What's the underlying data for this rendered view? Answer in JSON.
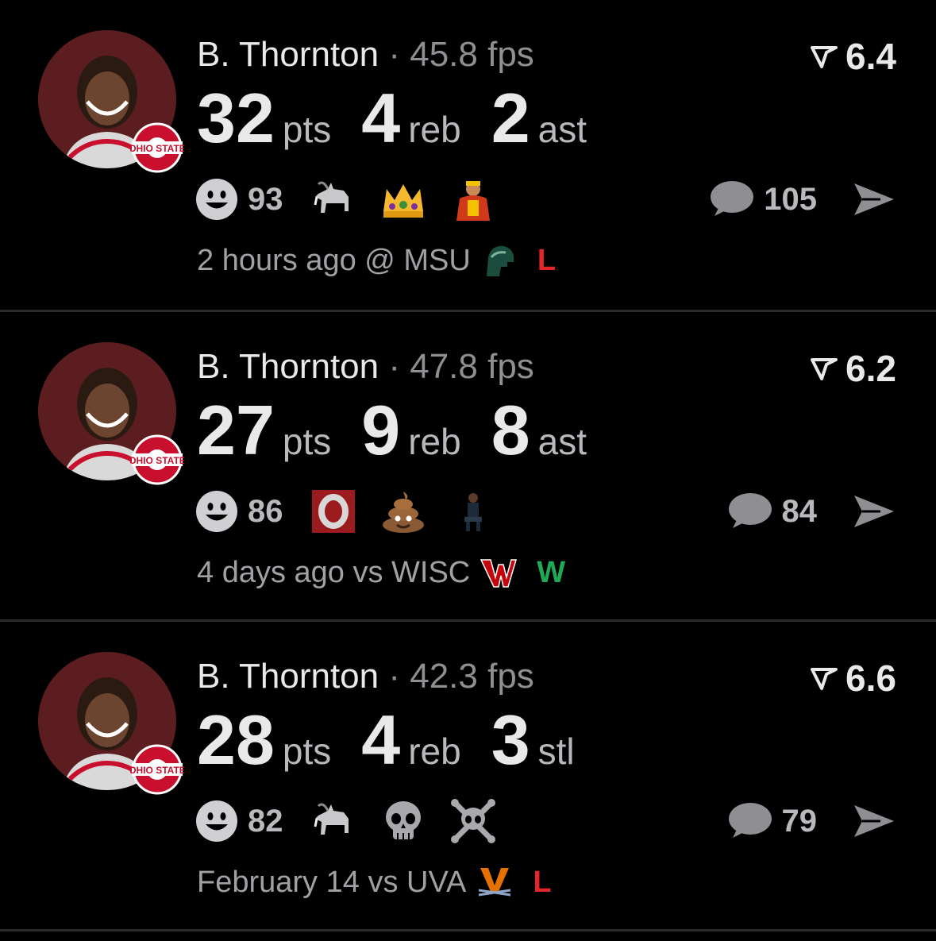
{
  "colors": {
    "background": "#000000",
    "loss": "#e4262b",
    "win": "#1faa55",
    "avatar_bg": "#5b1d1f"
  },
  "posts": [
    {
      "player": "B. Thornton",
      "separator": "·",
      "fps": "45.8 fps",
      "rating": "6.4",
      "stats": [
        {
          "value": "32",
          "unit": "pts"
        },
        {
          "value": "4",
          "unit": "reb"
        },
        {
          "value": "2",
          "unit": "ast"
        }
      ],
      "reaction_count": "93",
      "reaction_emojis": [
        "goat-emoji",
        "crown-emoji",
        "hulk-hogan-emoji"
      ],
      "comment_count": "105",
      "time": "2 hours ago @ MSU",
      "team_logo": "msu-spartan-icon",
      "result": "L"
    },
    {
      "player": "B. Thornton",
      "separator": "·",
      "fps": "47.8 fps",
      "rating": "6.2",
      "stats": [
        {
          "value": "27",
          "unit": "pts"
        },
        {
          "value": "9",
          "unit": "reb"
        },
        {
          "value": "8",
          "unit": "ast"
        }
      ],
      "reaction_count": "86",
      "reaction_emojis": [
        "ohio-state-o-emoji",
        "poop-emoji",
        "sitting-person-emoji"
      ],
      "comment_count": "84",
      "time": "4 days ago vs WISC",
      "team_logo": "wisconsin-w-icon",
      "result": "W"
    },
    {
      "player": "B. Thornton",
      "separator": "·",
      "fps": "42.3 fps",
      "rating": "6.6",
      "stats": [
        {
          "value": "28",
          "unit": "pts"
        },
        {
          "value": "4",
          "unit": "reb"
        },
        {
          "value": "3",
          "unit": "stl"
        }
      ],
      "reaction_count": "82",
      "reaction_emojis": [
        "goat-emoji",
        "skull-emoji",
        "skull-crossbones-emoji"
      ],
      "comment_count": "79",
      "time": "February 14 vs UVA",
      "team_logo": "virginia-v-icon",
      "result": "L"
    }
  ]
}
